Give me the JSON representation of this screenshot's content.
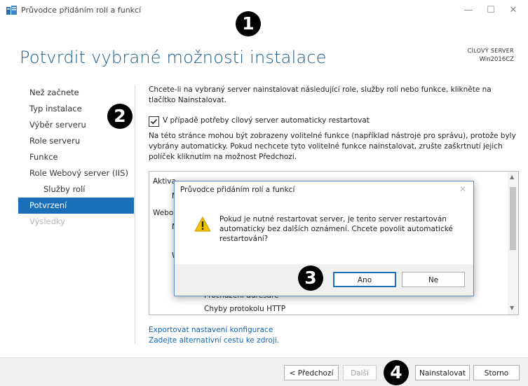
{
  "window": {
    "title": "Průvodce přidáním rolí a funkcí",
    "controls": {
      "minimize": "—",
      "maximize": "☐",
      "close": "✕"
    }
  },
  "page": {
    "title": "Potvrdit vybrané možnosti instalace",
    "destination_label": "CÍLOVÝ SERVER",
    "destination_value": "Win2016CZ"
  },
  "nav": {
    "items": [
      {
        "label": "Než začnete",
        "state": "normal"
      },
      {
        "label": "Typ instalace",
        "state": "normal"
      },
      {
        "label": "Výběr serveru",
        "state": "normal"
      },
      {
        "label": "Role serveru",
        "state": "normal"
      },
      {
        "label": "Funkce",
        "state": "normal"
      },
      {
        "label": "Role Webový server (IIS)",
        "state": "normal"
      },
      {
        "label": "Služby rolí",
        "state": "sub"
      },
      {
        "label": "Potvrzení",
        "state": "active"
      },
      {
        "label": "Výsledky",
        "state": "disabled"
      }
    ]
  },
  "content": {
    "intro": "Chcete-li na vybraný server nainstalovat následující role, služby rolí nebo funkce, klikněte na tlačítko Nainstalovat.",
    "restart_checkbox": {
      "label": "V případě potřeby cílový server automaticky restartovat",
      "checked": true
    },
    "optional_note": "Na této stránce mohou být zobrazeny volitelné funkce (například nástroje pro správu), protože byly vybrány automaticky. Pokud nechcete tyto volitelné funkce nainstalovat, zrušte zaškrtnutí jejich políček kliknutím na možnost Předchozí.",
    "list_items": [
      "Aktiva",
      "M",
      "Webo",
      "N",
      "W",
      "Procházení adresáře",
      "Chyby protokolu HTTP"
    ]
  },
  "links": {
    "export": "Exportovat nastavení konfigurace",
    "alt_source": "Zadejte alternativní cestu ke zdroji."
  },
  "footer": {
    "prev": "< Předchozí",
    "next": "Další",
    "install": "Nainstalovat",
    "cancel": "Storno"
  },
  "dialog": {
    "title": "Průvodce přidáním rolí a funkcí",
    "close": "✕",
    "message": "Pokud je nutné restartovat server, je tento server restartován automaticky bez dalších oznámení. Chcete povolit automatické restartování?",
    "yes": "Ano",
    "no": "Ne"
  },
  "markers": [
    "1",
    "2",
    "3",
    "4"
  ],
  "colors": {
    "accent": "#1a6fb8",
    "title": "#1a5a8a",
    "link": "#1464b4",
    "warning": "#f2c200"
  }
}
